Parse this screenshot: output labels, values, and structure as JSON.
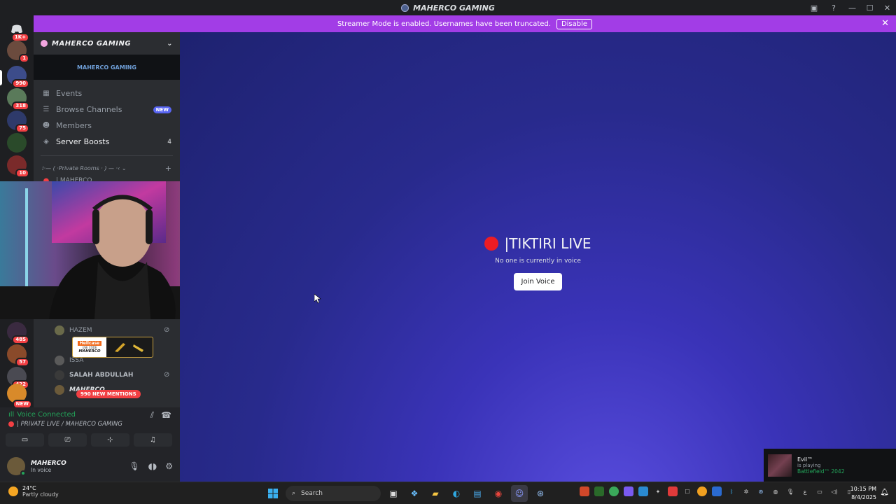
{
  "window": {
    "title": "MAHERCO GAMING"
  },
  "banner": {
    "text": "Streamer Mode is enabled. Usernames have been truncated.",
    "disable_label": "Disable",
    "close_glyph": "✕"
  },
  "guilds": {
    "badges": [
      "1K+",
      "1",
      "990",
      "318",
      "75",
      "10",
      "485",
      "57",
      "422",
      "NEW"
    ]
  },
  "server": {
    "name": "MAHERCO GAMING",
    "banner_text": "MAHERCO GAMING",
    "nav": [
      {
        "label": "Events",
        "icon": "calendar-icon"
      },
      {
        "label": "Browse Channels",
        "icon": "list-icon",
        "tag": "NEW"
      },
      {
        "label": "Members",
        "icon": "members-icon"
      },
      {
        "label": "Server Boosts",
        "icon": "boost-icon",
        "count": "4"
      }
    ],
    "category": "⁞·— ( ·Private Rooms · ) — ·‹ ⌄",
    "partial_channel": "| MAHERCO"
  },
  "members": [
    {
      "name": "HAZEM"
    },
    {
      "name": "ISSA"
    },
    {
      "name": "SALAH ABDULLAH"
    },
    {
      "name": "MAHERCO"
    }
  ],
  "sponsor": {
    "brand": "Hellcase",
    "code_label": "USE CODE",
    "code": "MAHERCO"
  },
  "mentions": "990 NEW MENTIONS",
  "voice": {
    "status": "Voice Connected",
    "channel": "| PRIVATE LIVE / MAHERCO GAMING"
  },
  "user": {
    "name": "MAHERCO",
    "status": "In voice"
  },
  "stage": {
    "title": "|TIKTIRI LIVE",
    "subtitle": "No one is currently in voice",
    "join_label": "Join Voice"
  },
  "toast": {
    "name": "Evil™",
    "activity": "is playing",
    "game": "Battlefield™ 2042"
  },
  "taskbar": {
    "weather_temp": "24°C",
    "weather_desc": "Partly cloudy",
    "search_placeholder": "Search",
    "time": "10:15 PM",
    "date": "8/4/2025"
  },
  "colors": {
    "accent": "#a23de6",
    "live_red": "#ed1c24",
    "online_green": "#23a55a",
    "blurple": "#5865f2"
  }
}
